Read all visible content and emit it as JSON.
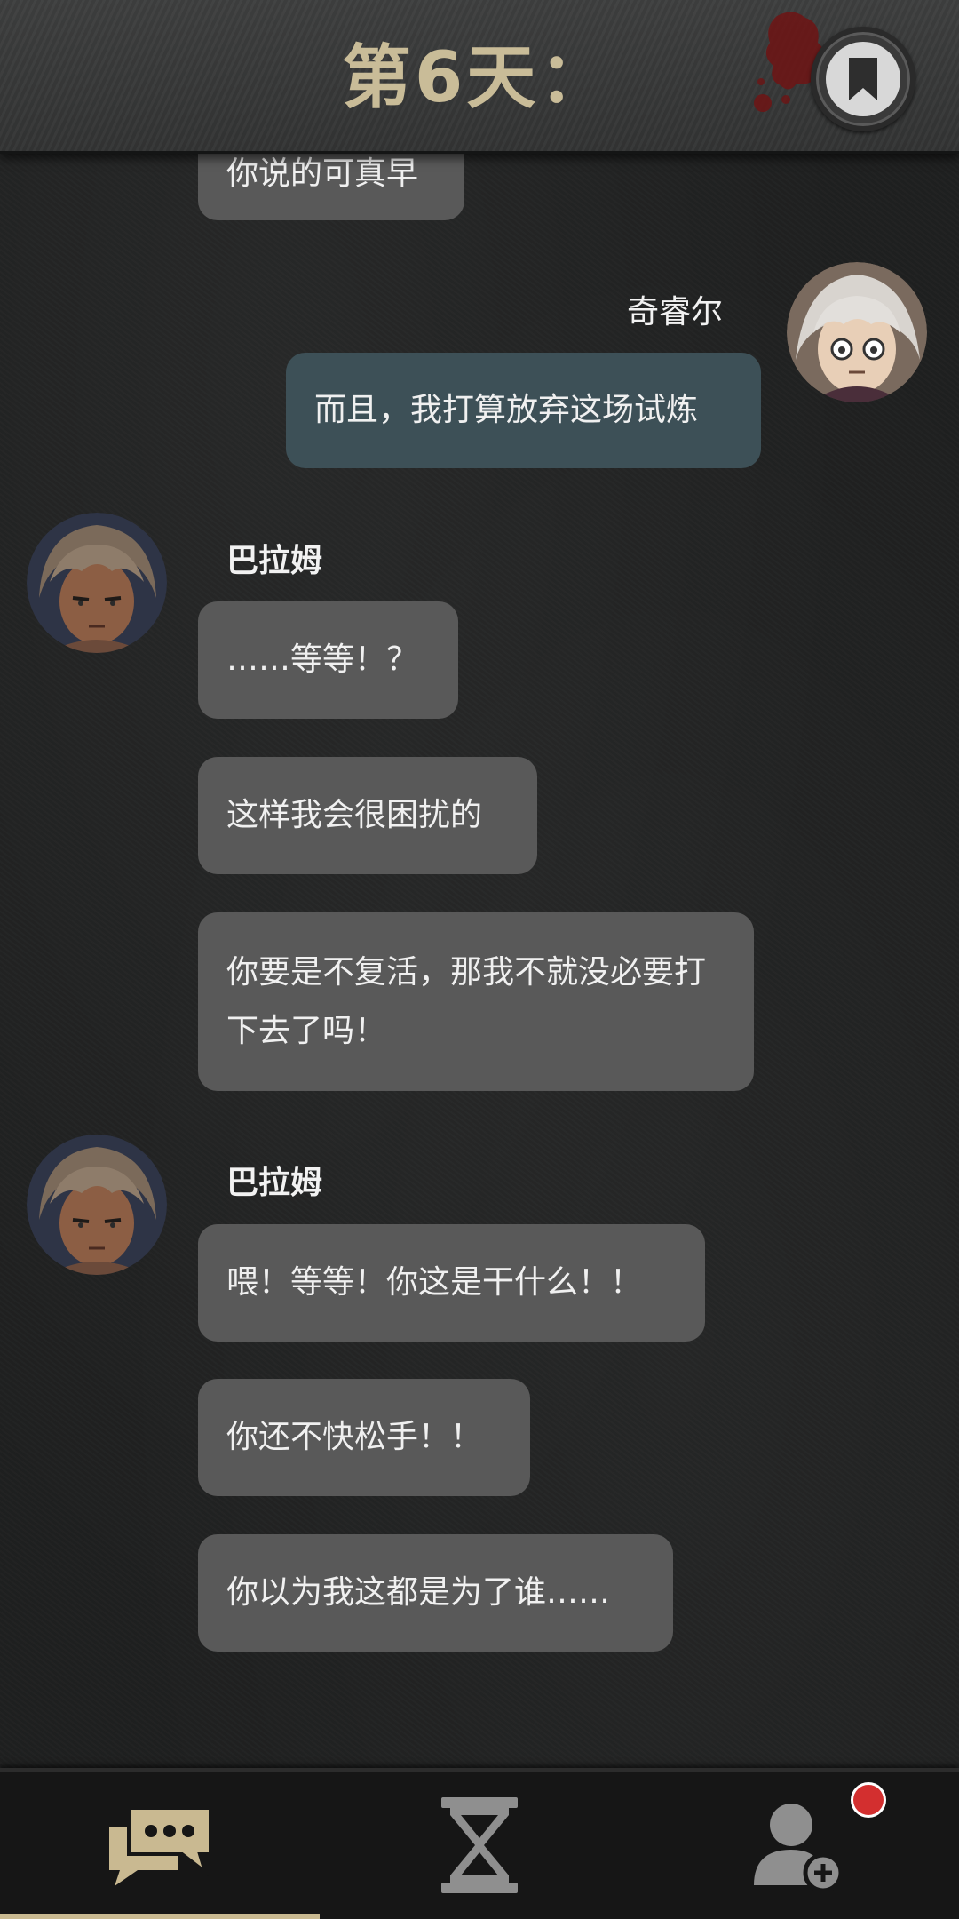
{
  "header": {
    "title": "第6天："
  },
  "messages": [
    {
      "text": "你说的可真早"
    },
    {
      "sender": "奇睿尔",
      "text": "而且，我打算放弃这场试炼"
    },
    {
      "sender": "巴拉姆",
      "texts": [
        "……等等！？",
        "这样我会很困扰的",
        "你要是不复活，那我不就没必要打下去了吗！"
      ]
    },
    {
      "sender": "巴拉姆",
      "texts": [
        "喂！等等！你这是干什么！！",
        "你还不快松手！！",
        "你以为我这都是为了谁……"
      ]
    }
  ],
  "colors": {
    "self_bubble": "#3d5057",
    "other_bubble": "#595959",
    "accent": "#c9b991",
    "notification": "#d32f2f"
  },
  "bottom_nav": {
    "tabs": [
      {
        "icon": "chat-bubbles-icon",
        "active": true
      },
      {
        "icon": "hourglass-icon",
        "active": false
      },
      {
        "icon": "add-contact-icon",
        "active": false,
        "notification": true
      }
    ]
  }
}
